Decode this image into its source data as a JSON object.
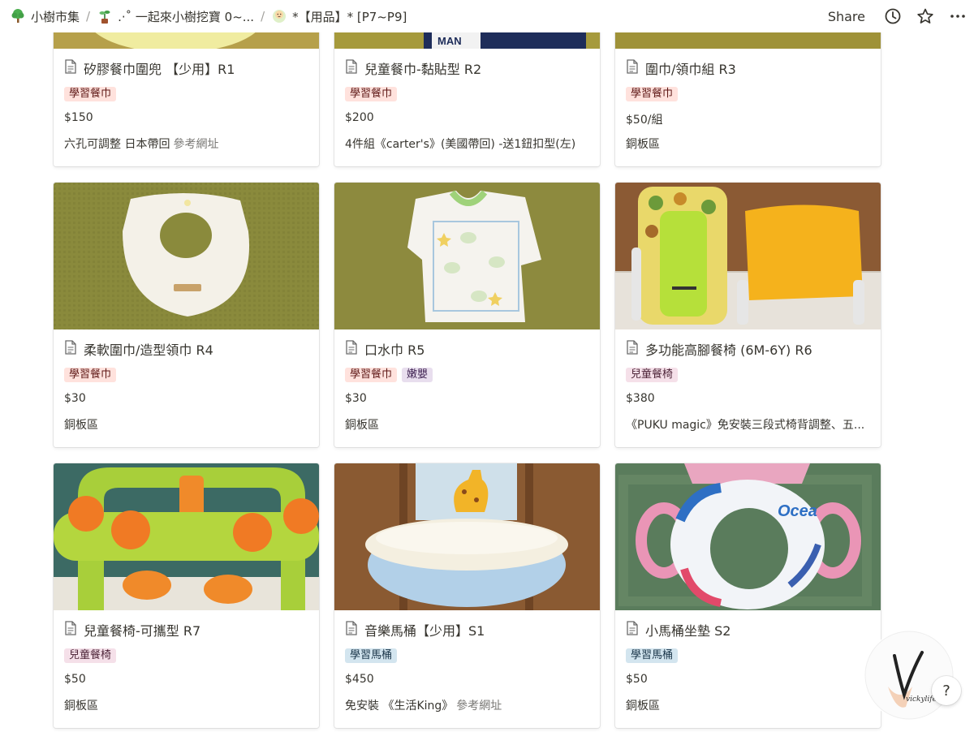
{
  "breadcrumb": {
    "items": [
      "小樹市集",
      ".‧˚ 一起來小樹挖寶 0~...",
      "*【用品】* [P7~P9]"
    ],
    "separator": "/"
  },
  "header": {
    "share_label": "Share",
    "more_label": "···"
  },
  "cards": [
    {
      "title": "矽膠餐巾圍兜 【少用】R1",
      "tags": [
        {
          "label": "學習餐巾",
          "color": "red"
        }
      ],
      "price": "$150",
      "note": "六孔可調整 日本帶回",
      "note_link": "參考網址"
    },
    {
      "title": "兒童餐巾-黏貼型 R2",
      "tags": [
        {
          "label": "學習餐巾",
          "color": "red"
        }
      ],
      "price": "$200",
      "note": "4件組《carter's》(美國帶回) -送1鈕扣型(左)",
      "note_link": ""
    },
    {
      "title": "圍巾/領巾組 R3",
      "tags": [
        {
          "label": "學習餐巾",
          "color": "red"
        }
      ],
      "price": "$50/組",
      "note": "銅板區",
      "note_link": ""
    },
    {
      "title": "柔軟圍巾/造型領巾 R4",
      "tags": [
        {
          "label": "學習餐巾",
          "color": "red"
        }
      ],
      "price": "$30",
      "note": "銅板區",
      "note_link": ""
    },
    {
      "title": "口水巾 R5",
      "tags": [
        {
          "label": "學習餐巾",
          "color": "red"
        },
        {
          "label": "嫩嬰",
          "color": "purple"
        }
      ],
      "price": "$30",
      "note": "銅板區",
      "note_link": ""
    },
    {
      "title": "多功能高腳餐椅 (6M-6Y) R6",
      "tags": [
        {
          "label": "兒童餐椅",
          "color": "pink"
        }
      ],
      "price": "$380",
      "note": "《PUKU magic》免安裝三段式椅背調整、五...",
      "note_link": ""
    },
    {
      "title": "兒童餐椅-可攜型 R7",
      "tags": [
        {
          "label": "兒童餐椅",
          "color": "pink"
        }
      ],
      "price": "$50",
      "note": "銅板區",
      "note_link": ""
    },
    {
      "title": "音樂馬桶【少用】S1",
      "tags": [
        {
          "label": "學習馬桶",
          "color": "blue"
        }
      ],
      "price": "$450",
      "note": "免安裝 《生活King》",
      "note_link": "參考網址"
    },
    {
      "title": "小馬桶坐墊 S2",
      "tags": [
        {
          "label": "學習馬桶",
          "color": "blue"
        }
      ],
      "price": "$50",
      "note": "銅板區",
      "note_link": ""
    }
  ],
  "help": {
    "label": "?"
  },
  "watermark": {
    "text": "vickylife"
  },
  "colors": {
    "tag_red": "#ffe2dd",
    "tag_pink": "#f5e0e9",
    "tag_purple": "#e8deee",
    "tag_blue": "#d3e5ef",
    "text": "#37352f",
    "muted": "#787774"
  }
}
